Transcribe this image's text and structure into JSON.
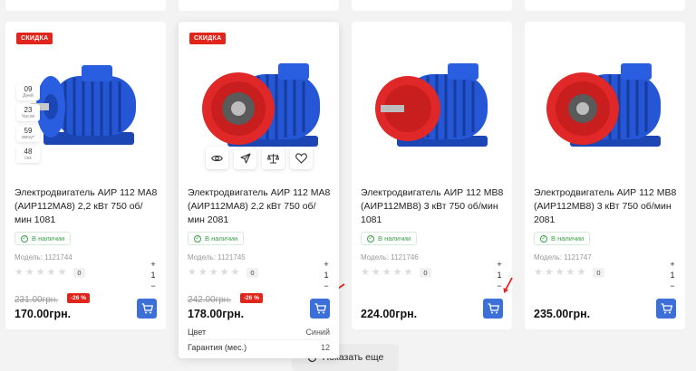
{
  "products": [
    {
      "sale_badge": "СКИДКА",
      "title": "Электродвигатель АИР 112 МА8 (АИР112МА8) 2,2 кВт 750 об/мин 1081",
      "stock": "В наличии",
      "model": "Модель: 1121744",
      "rating_count": "0",
      "qty": "1",
      "old_price": "231.00грн.",
      "discount": "-26 %",
      "price": "170.00грн.",
      "motor_color": "blue",
      "timer": [
        {
          "value": "09",
          "label": "Дней"
        },
        {
          "value": "23",
          "label": "Часов"
        },
        {
          "value": "59",
          "label": "минут"
        },
        {
          "value": "48",
          "label": "сек"
        }
      ]
    },
    {
      "sale_badge": "СКИДКА",
      "title": "Электродвигатель АИР 112 МА8 (АИР112МА8) 2,2 кВт 750 об/мин 2081",
      "stock": "В наличии",
      "model": "Модель: 1121745",
      "rating_count": "0",
      "qty": "1",
      "old_price": "242.00грн.",
      "discount": "-26 %",
      "price": "178.00грн.",
      "motor_color": "red-flange",
      "actions": [
        "eye-icon",
        "send-icon",
        "scales-icon",
        "heart-icon"
      ],
      "specs": [
        {
          "name": "Цвет",
          "value": "Синий"
        },
        {
          "name": "Гарантия (мес.)",
          "value": "12"
        }
      ]
    },
    {
      "title": "Электродвигатель АИР 112 МВ8 (АИР112МВ8) 3 кВт 750 об/мин 1081",
      "stock": "В наличии",
      "model": "Модель: 1121746",
      "rating_count": "0",
      "qty": "1",
      "price": "224.00грн.",
      "motor_color": "red-flange"
    },
    {
      "title": "Электродвигатель АИР 112 МВ8 (АИР112МВ8) 3 кВт 750 об/мин 2081",
      "stock": "В наличии",
      "model": "Модель: 1121747",
      "rating_count": "0",
      "qty": "1",
      "price": "235.00грн.",
      "motor_color": "red-flange"
    }
  ],
  "load_more_label": "Показать еще",
  "colors": {
    "accent": "#3d6fd8",
    "sale": "#e1251b",
    "stock": "#3aa04a",
    "motor_blue": "#1f4fc4",
    "motor_red": "#e02828"
  }
}
